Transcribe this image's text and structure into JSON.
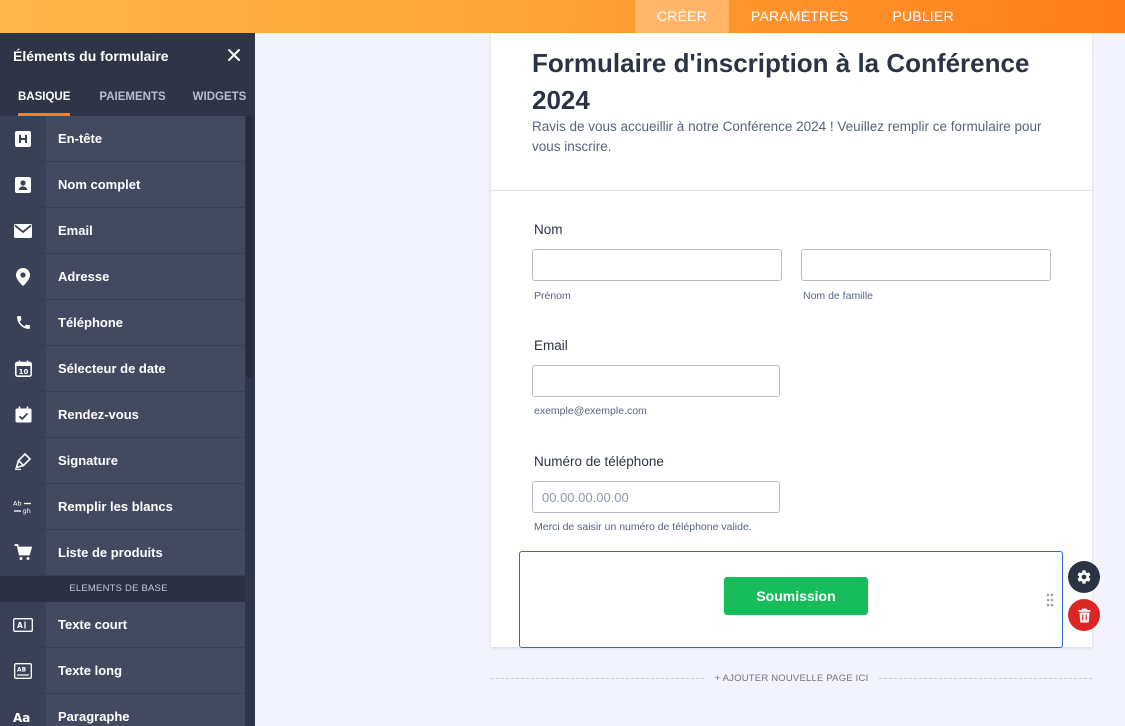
{
  "topnav": {
    "tabs": [
      "CRÉER",
      "PARAMÈTRES",
      "PUBLIER"
    ],
    "active_index": 0
  },
  "sidebar": {
    "title": "Éléments du formulaire",
    "tabs": [
      "BASIQUE",
      "PAIEMENTS",
      "WIDGETS"
    ],
    "active_tab": 0,
    "items": [
      {
        "label": "En-tête",
        "icon": "heading-icon"
      },
      {
        "label": "Nom complet",
        "icon": "contact-card-icon"
      },
      {
        "label": "Email",
        "icon": "envelope-icon"
      },
      {
        "label": "Adresse",
        "icon": "map-pin-icon"
      },
      {
        "label": "Téléphone",
        "icon": "phone-icon"
      },
      {
        "label": "Sélecteur de date",
        "icon": "calendar-icon"
      },
      {
        "label": "Rendez-vous",
        "icon": "calendar-check-icon"
      },
      {
        "label": "Signature",
        "icon": "signature-pen-icon"
      },
      {
        "label": "Remplir les blancs",
        "icon": "fill-blanks-icon"
      },
      {
        "label": "Liste de produits",
        "icon": "cart-icon"
      }
    ],
    "section_label": "ELEMENTS DE BASE",
    "base_items": [
      {
        "label": "Texte court",
        "icon": "short-text-icon"
      },
      {
        "label": "Texte long",
        "icon": "long-text-icon"
      },
      {
        "label": "Paragraphe",
        "icon": "paragraph-icon"
      }
    ]
  },
  "form": {
    "title": "Formulaire d'inscription à la Conférence 2024",
    "subtitle": "Ravis de vous accueillir à notre Conférence 2024 ! Veuillez remplir ce formulaire pour vous inscrire.",
    "name": {
      "label": "Nom",
      "first_hint": "Prénom",
      "last_hint": "Nom de famille"
    },
    "email": {
      "label": "Email",
      "hint": "exemple@exemple.com"
    },
    "phone": {
      "label": "Numéro de téléphone",
      "placeholder": "00.00.00.00.00",
      "hint": "Merci de saisir un numéro de téléphone valide."
    },
    "submit_label": "Soumission"
  },
  "add_page_label": "+ AJOUTER NOUVELLE PAGE ICI",
  "colors": {
    "accent": "#ff7d1a",
    "submit": "#18bd5b",
    "selection": "#2e69d4",
    "delete": "#dc2626"
  }
}
